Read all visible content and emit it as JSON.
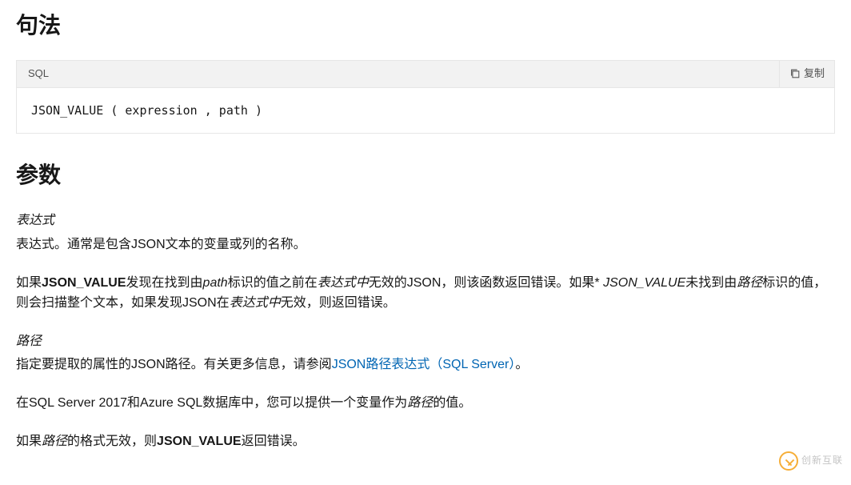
{
  "syntax": {
    "heading": "句法",
    "language_label": "SQL",
    "copy_label": "复制",
    "code": "JSON_VALUE ( expression , path )"
  },
  "params": {
    "heading": "参数",
    "expression": {
      "title": "表达式",
      "line1": "表达式。通常是包含JSON文本的变量或列的名称。",
      "line2_pre": "如果",
      "line2_bold1": "JSON_VALUE",
      "line2_mid1": "发现在找到由",
      "line2_em1": "path",
      "line2_mid2": "标识的值之前在",
      "line2_em2": "表达式中",
      "line2_mid3": "无效的JSON，则该函数返回错误。如果* ",
      "line2_em3": "JSON_VALUE",
      "line2_mid4": "未找到由",
      "line2_em4": "路径",
      "line2_mid5": "标识的值，则会扫描整个文本，如果发现JSON在",
      "line2_em5": "表达式中",
      "line2_mid6": "无效，则返回错误。"
    },
    "path": {
      "title": "路径",
      "line1_pre": "指定要提取的属性的JSON路径。有关更多信息，请参阅",
      "line1_link": "JSON路径表达式（SQL Server）",
      "line1_post": "。",
      "line2_pre": "在SQL Server 2017和Azure SQL数据库中，您可以提供一个变量作为",
      "line2_em": "路径",
      "line2_post": "的值。",
      "line3_pre": "如果",
      "line3_em": "路径",
      "line3_mid": "的格式无效，则",
      "line3_bold": "JSON_VALUE",
      "line3_post": "返回错误。"
    }
  },
  "watermark": "创新互联"
}
